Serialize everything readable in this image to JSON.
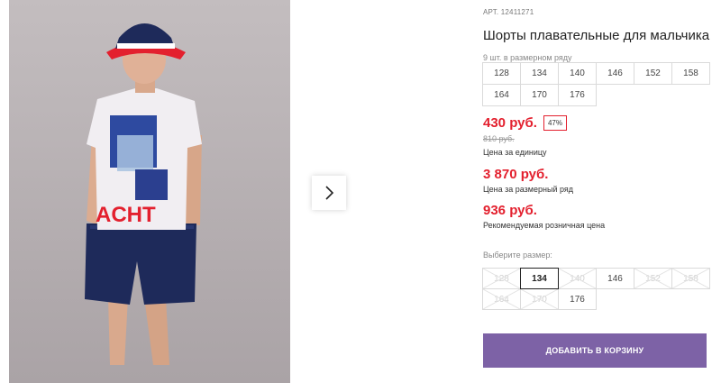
{
  "product": {
    "article": "АРТ. 12411271",
    "title": "Шорты плавательные для мальчика",
    "range_caption": "9 шт. в размерном ряду",
    "range_sizes": [
      "128",
      "134",
      "140",
      "146",
      "152",
      "158",
      "164",
      "170",
      "176"
    ]
  },
  "pricing": {
    "price": "430 руб.",
    "discount": "47%",
    "old_price": "810 руб.",
    "unit_caption": "Цена за единицу",
    "range_price": "3 870 руб.",
    "range_caption": "Цена за размерный ряд",
    "rrp": "936 руб.",
    "rrp_caption": "Рекомендуемая розничная цена"
  },
  "size_select": {
    "caption": "Выберите размер:",
    "options": [
      {
        "label": "128",
        "state": "disabled"
      },
      {
        "label": "134",
        "state": "selected"
      },
      {
        "label": "140",
        "state": "disabled"
      },
      {
        "label": "146",
        "state": "available"
      },
      {
        "label": "152",
        "state": "disabled"
      },
      {
        "label": "158",
        "state": "disabled"
      },
      {
        "label": "164",
        "state": "disabled"
      },
      {
        "label": "170",
        "state": "disabled"
      },
      {
        "label": "176",
        "state": "available"
      }
    ]
  },
  "cart": {
    "button_label": "ДОБАВИТЬ В КОРЗИНУ"
  },
  "gallery": {
    "next_icon": "chevron-right-icon"
  },
  "colors": {
    "accent": "#7d62a6",
    "price": "#e3202e",
    "photo_bg": "#b9b3b5"
  }
}
